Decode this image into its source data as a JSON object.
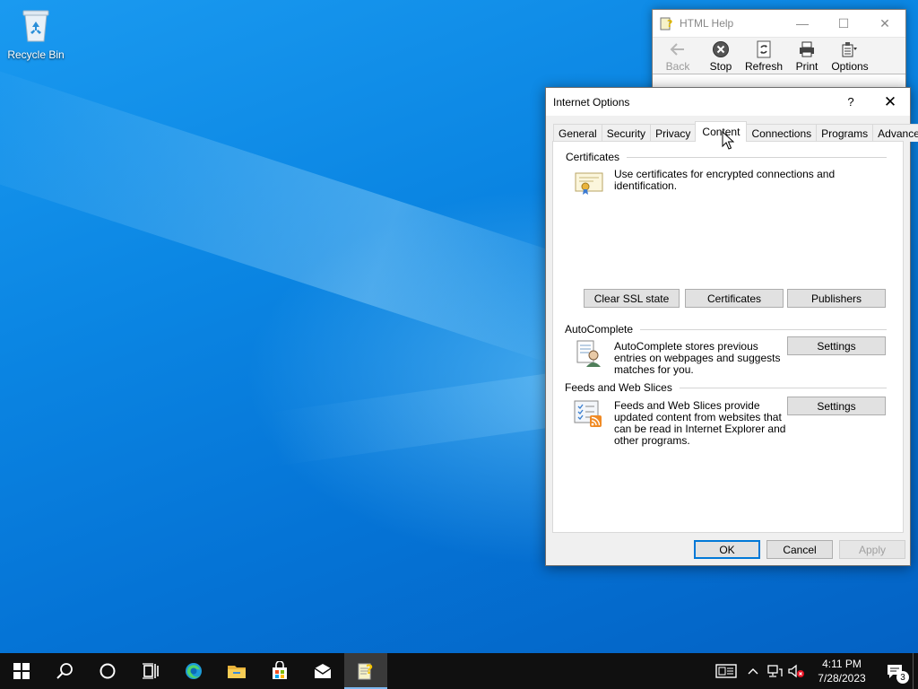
{
  "desktop": {
    "icons": [
      {
        "label": "Recycle Bin",
        "icon": "recycle-bin-icon"
      }
    ]
  },
  "help_window": {
    "title": "HTML Help",
    "toolbar": [
      {
        "label": "Back",
        "icon": "back-arrow-icon",
        "enabled": false
      },
      {
        "label": "Stop",
        "icon": "stop-icon",
        "enabled": true
      },
      {
        "label": "Refresh",
        "icon": "refresh-icon",
        "enabled": true
      },
      {
        "label": "Print",
        "icon": "printer-icon",
        "enabled": true
      },
      {
        "label": "Options",
        "icon": "options-icon",
        "enabled": true
      }
    ]
  },
  "dialog": {
    "title": "Internet Options",
    "help_symbol": "?",
    "tabs": [
      "General",
      "Security",
      "Privacy",
      "Content",
      "Connections",
      "Programs",
      "Advanced"
    ],
    "active_tab": "Content",
    "certificates": {
      "heading": "Certificates",
      "description": "Use certificates for encrypted connections and identification.",
      "buttons": [
        "Clear SSL state",
        "Certificates",
        "Publishers"
      ]
    },
    "autocomplete": {
      "heading": "AutoComplete",
      "description": "AutoComplete stores previous entries on webpages and suggests matches for you.",
      "button": "Settings"
    },
    "feeds": {
      "heading": "Feeds and Web Slices",
      "description": "Feeds and Web Slices provide updated content from websites that can be read in Internet Explorer and other programs.",
      "button": "Settings"
    },
    "footer": {
      "ok": "OK",
      "cancel": "Cancel",
      "apply": "Apply"
    }
  },
  "taskbar": {
    "apps": [
      "start-icon",
      "search-icon",
      "cortana-icon",
      "task-view-icon",
      "edge-icon",
      "file-explorer-icon",
      "store-icon",
      "mail-icon",
      "html-help-icon"
    ],
    "active_app": "html-help-icon",
    "clock": {
      "time": "4:11 PM",
      "date": "7/28/2023"
    },
    "notification_count": "3"
  },
  "colors": {
    "accent": "#0078d7",
    "taskbar": "#101010",
    "desktop": "#0a78d4"
  }
}
